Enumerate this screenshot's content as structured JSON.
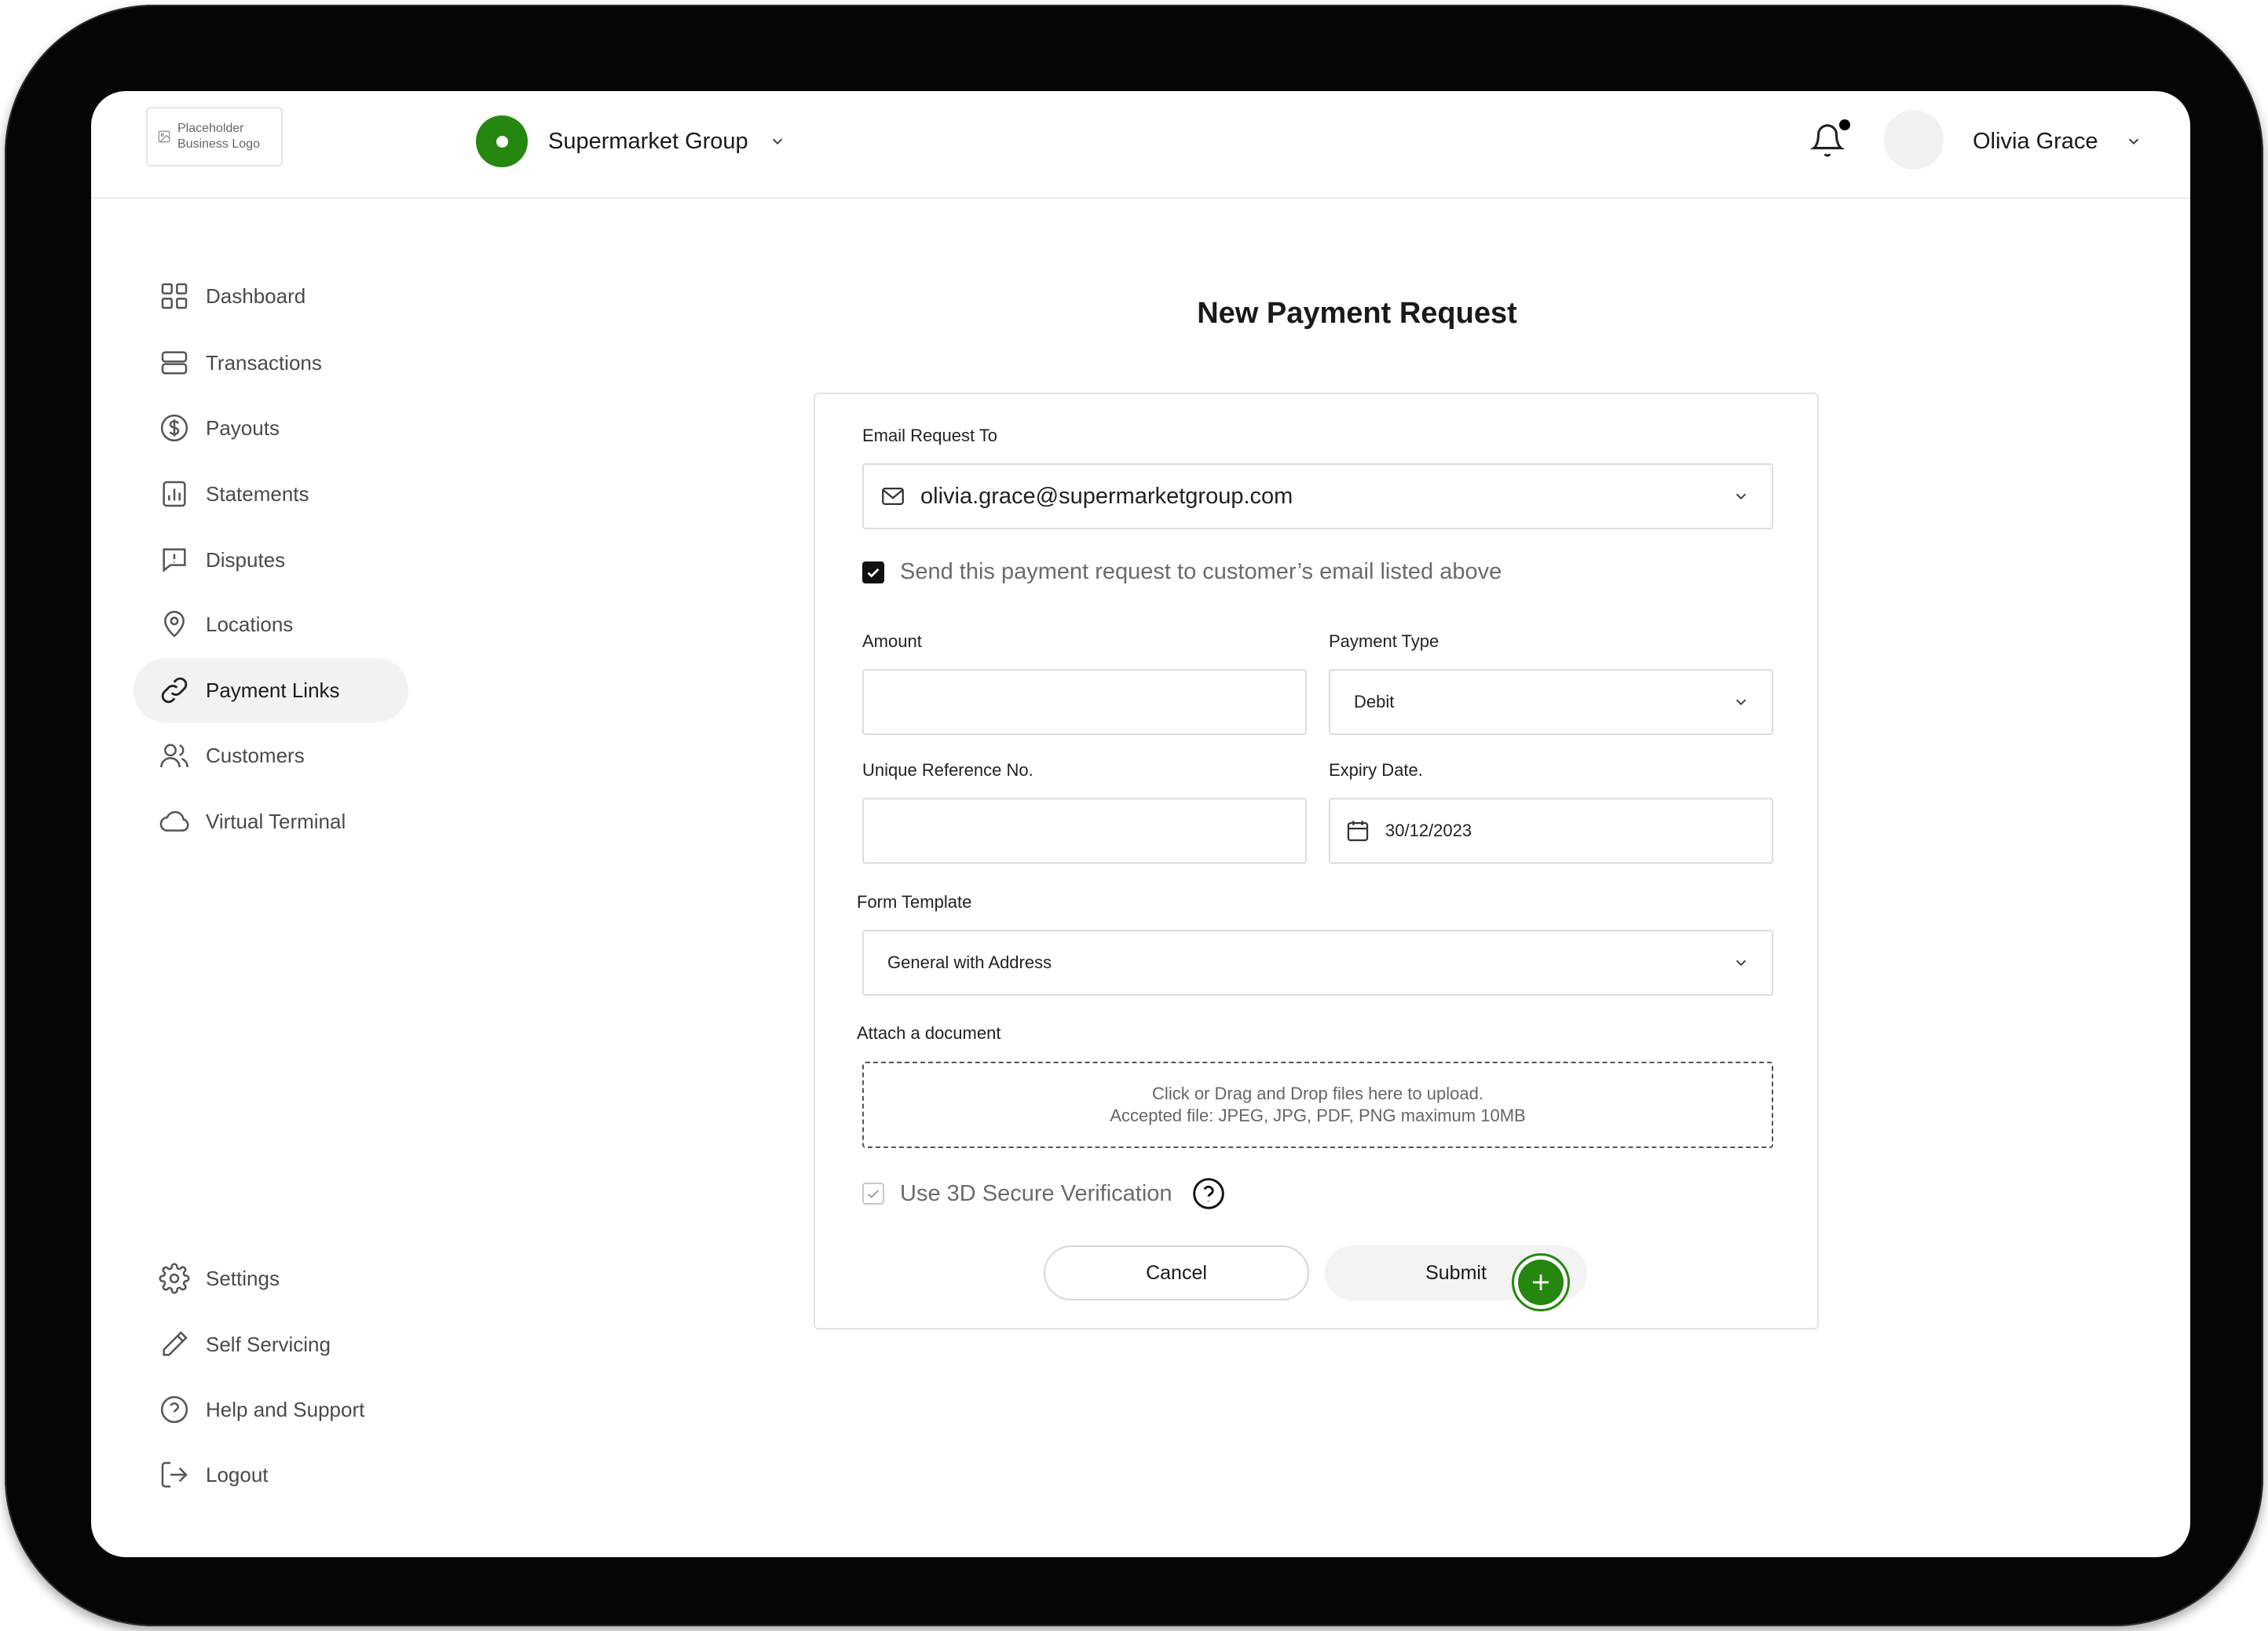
{
  "brand": {
    "logo_text_line1": "Placeholder",
    "logo_text_line2": "Business Logo",
    "business_name": "Supermarket Group",
    "accent_color": "#25870f"
  },
  "user": {
    "name": "Olivia Grace",
    "has_notification": true
  },
  "sidebar": {
    "items": [
      {
        "label": "Dashboard",
        "icon": "grid-icon"
      },
      {
        "label": "Transactions",
        "icon": "stack-icon"
      },
      {
        "label": "Payouts",
        "icon": "dollar-circle-icon"
      },
      {
        "label": "Statements",
        "icon": "bar-chart-icon"
      },
      {
        "label": "Disputes",
        "icon": "alert-message-icon"
      },
      {
        "label": "Locations",
        "icon": "map-pin-icon"
      },
      {
        "label": "Payment Links",
        "icon": "link-icon",
        "active": true
      },
      {
        "label": "Customers",
        "icon": "users-icon"
      },
      {
        "label": "Virtual Terminal",
        "icon": "cloud-icon"
      }
    ],
    "bottom_items": [
      {
        "label": "Settings",
        "icon": "gear-icon"
      },
      {
        "label": "Self Servicing",
        "icon": "pencil-icon"
      },
      {
        "label": "Help and Support",
        "icon": "help-circle-icon"
      },
      {
        "label": "Logout",
        "icon": "logout-icon"
      }
    ]
  },
  "form": {
    "title": "New Payment Request",
    "email_label": "Email Request To",
    "email_value": "olivia.grace@supermarketgroup.com",
    "send_email_checkbox_label": "Send this payment request to customer’s email listed above",
    "send_email_checked": true,
    "amount_label": "Amount",
    "amount_value": "",
    "payment_type_label": "Payment Type",
    "payment_type_value": "Debit",
    "reference_label": "Unique Reference No.",
    "reference_value": "",
    "expiry_label": "Expiry Date.",
    "expiry_value": "30/12/2023",
    "template_label": "Form Template",
    "template_value": "General with Address",
    "attach_label": "Attach a document",
    "upload_line1": "Click or Drag and Drop files here to upload.",
    "upload_line2": "Accepted file: JPEG, JPG, PDF, PNG maximum 10MB",
    "secure_label": "Use 3D Secure Verification",
    "secure_checked": true,
    "cancel_label": "Cancel",
    "submit_label": "Submit"
  }
}
